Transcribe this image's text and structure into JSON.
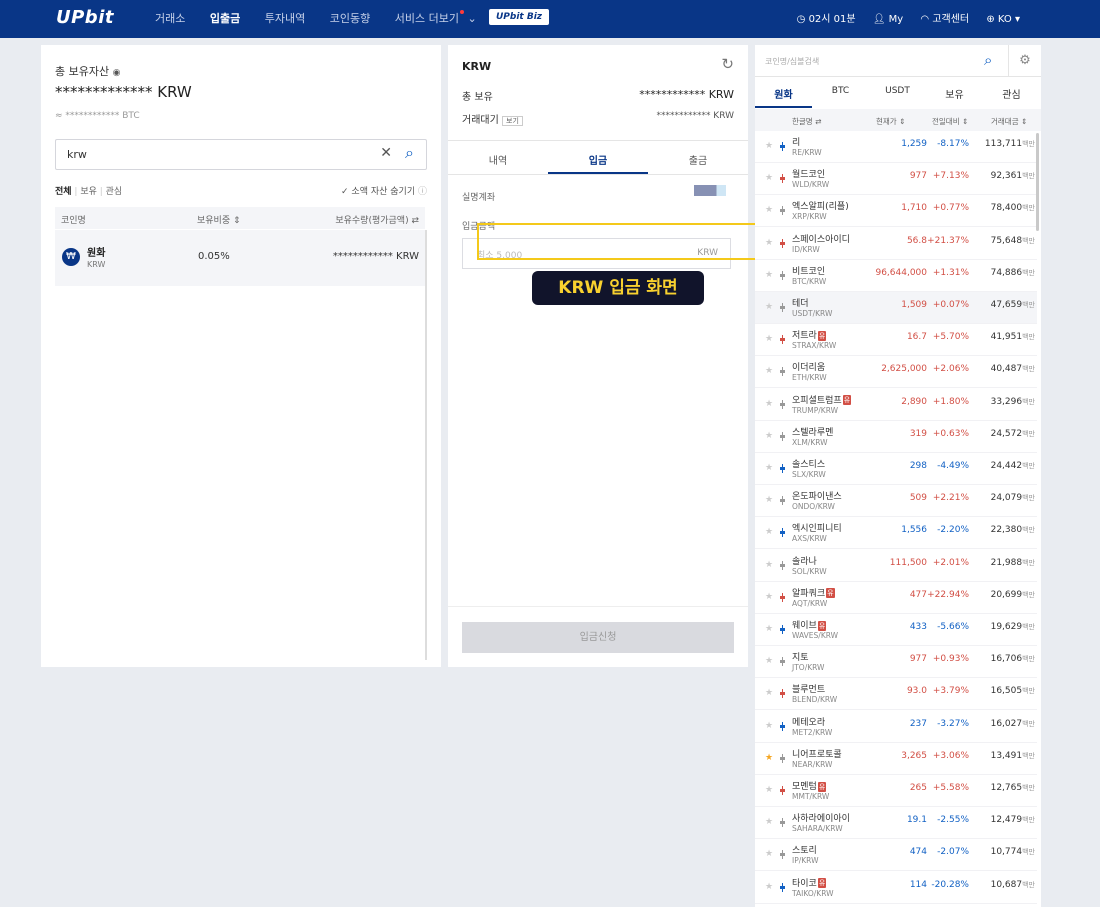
{
  "header": {
    "logo": "UPbit",
    "nav": [
      "거래소",
      "입출금",
      "투자내역",
      "코인동향",
      "서비스 더보기"
    ],
    "biz": "UPbit Biz",
    "time": "02시 01분",
    "my": "My",
    "support": "고객센터",
    "lang": "KO"
  },
  "assets": {
    "title": "총 보유자산",
    "total": "************* KRW",
    "btc": "≈ ************ BTC",
    "search_value": "krw",
    "filters": [
      "전체",
      "보유",
      "관심"
    ],
    "hide_small": "소액 자산 숨기기",
    "cols": [
      "코인명",
      "보유비중",
      "보유수량(평가금액)"
    ],
    "row": {
      "name": "원화",
      "code": "KRW",
      "ratio": "0.05%",
      "amount": "************ KRW"
    }
  },
  "deposit": {
    "title": "KRW",
    "hold_label": "총 보유",
    "hold_value": "************ KRW",
    "pending_label": "거래대기",
    "view": "보기",
    "pending_value": "************ KRW",
    "tabs": [
      "내역",
      "입금",
      "출금"
    ],
    "account_label": "실명계좌",
    "amount_label": "입금금액",
    "amount_placeholder": "최소 5,000",
    "unit": "KRW",
    "submit": "입금신청",
    "callout": "KRW 입금 화면"
  },
  "market": {
    "search_placeholder": "코인명/심볼검색",
    "tabs": [
      "원화",
      "BTC",
      "USDT",
      "보유",
      "관심"
    ],
    "cols": [
      "한글명",
      "현재가",
      "전일대비",
      "거래대금"
    ],
    "unit": "백만",
    "rows": [
      {
        "name": "리",
        "market": "RE/KRW",
        "price": "1,259",
        "change": "-8.17%",
        "volume": "113,711",
        "dir": "dn",
        "bar": "#1261c4"
      },
      {
        "name": "월드코인",
        "market": "WLD/KRW",
        "price": "977",
        "change": "+7.13%",
        "volume": "92,361",
        "dir": "up",
        "bar": "#d24f45"
      },
      {
        "name": "엑스알피(리플)",
        "market": "XRP/KRW",
        "price": "1,710",
        "change": "+0.77%",
        "volume": "78,400",
        "dir": "up",
        "bar": "#999"
      },
      {
        "name": "스페이스아이디",
        "market": "ID/KRW",
        "price": "56.8",
        "change": "+21.37%",
        "volume": "75,648",
        "dir": "up",
        "bar": "#d24f45"
      },
      {
        "name": "비트코인",
        "market": "BTC/KRW",
        "price": "96,644,000",
        "change": "+1.31%",
        "volume": "74,886",
        "dir": "up",
        "bar": "#999"
      },
      {
        "name": "테더",
        "market": "USDT/KRW",
        "price": "1,509",
        "change": "+0.07%",
        "volume": "47,659",
        "dir": "up",
        "bar": "#999"
      },
      {
        "name": "저트라",
        "market": "STRAX/KRW",
        "price": "16.7",
        "change": "+5.70%",
        "volume": "41,951",
        "dir": "up",
        "bar": "#d24f45",
        "badge": "유"
      },
      {
        "name": "이더리움",
        "market": "ETH/KRW",
        "price": "2,625,000",
        "change": "+2.06%",
        "volume": "40,487",
        "dir": "up",
        "bar": "#999"
      },
      {
        "name": "오피셜트럼프",
        "market": "TRUMP/KRW",
        "price": "2,890",
        "change": "+1.80%",
        "volume": "33,296",
        "dir": "up",
        "bar": "#999",
        "badge": "유"
      },
      {
        "name": "스텔라루멘",
        "market": "XLM/KRW",
        "price": "319",
        "change": "+0.63%",
        "volume": "24,572",
        "dir": "up",
        "bar": "#999"
      },
      {
        "name": "솔스티스",
        "market": "SLX/KRW",
        "price": "298",
        "change": "-4.49%",
        "volume": "24,442",
        "dir": "dn",
        "bar": "#1261c4"
      },
      {
        "name": "온도파이낸스",
        "market": "ONDO/KRW",
        "price": "509",
        "change": "+2.21%",
        "volume": "24,079",
        "dir": "up",
        "bar": "#999"
      },
      {
        "name": "엑시인피니티",
        "market": "AXS/KRW",
        "price": "1,556",
        "change": "-2.20%",
        "volume": "22,380",
        "dir": "dn",
        "bar": "#1261c4"
      },
      {
        "name": "솔라나",
        "market": "SOL/KRW",
        "price": "111,500",
        "change": "+2.01%",
        "volume": "21,988",
        "dir": "up",
        "bar": "#999"
      },
      {
        "name": "알파쿼크",
        "market": "AQT/KRW",
        "price": "477",
        "change": "+22.94%",
        "volume": "20,699",
        "dir": "up",
        "bar": "#d24f45",
        "badge": "유"
      },
      {
        "name": "웨이브",
        "market": "WAVES/KRW",
        "price": "433",
        "change": "-5.66%",
        "volume": "19,629",
        "dir": "dn",
        "bar": "#1261c4",
        "badge": "유"
      },
      {
        "name": "지토",
        "market": "JTO/KRW",
        "price": "977",
        "change": "+0.93%",
        "volume": "16,706",
        "dir": "up",
        "bar": "#999"
      },
      {
        "name": "블루먼트",
        "market": "BLEND/KRW",
        "price": "93.0",
        "change": "+3.79%",
        "volume": "16,505",
        "dir": "up",
        "bar": "#d24f45"
      },
      {
        "name": "메테오라",
        "market": "MET2/KRW",
        "price": "237",
        "change": "-3.27%",
        "volume": "16,027",
        "dir": "dn",
        "bar": "#1261c4"
      },
      {
        "name": "니어프로토콜",
        "market": "NEAR/KRW",
        "price": "3,265",
        "change": "+3.06%",
        "volume": "13,491",
        "dir": "up",
        "bar": "#999",
        "fav": true
      },
      {
        "name": "모멘텀",
        "market": "MMT/KRW",
        "price": "265",
        "change": "+5.58%",
        "volume": "12,765",
        "dir": "up",
        "bar": "#d24f45",
        "badge": "유"
      },
      {
        "name": "사하라에이아이",
        "market": "SAHARA/KRW",
        "price": "19.1",
        "change": "-2.55%",
        "volume": "12,479",
        "dir": "dn",
        "bar": "#999"
      },
      {
        "name": "스토리",
        "market": "IP/KRW",
        "price": "474",
        "change": "-2.07%",
        "volume": "10,774",
        "dir": "dn",
        "bar": "#999"
      },
      {
        "name": "타이코",
        "market": "TAIKO/KRW",
        "price": "114",
        "change": "-20.28%",
        "volume": "10,687",
        "dir": "dn",
        "bar": "#1261c4",
        "badge": "유"
      }
    ]
  }
}
